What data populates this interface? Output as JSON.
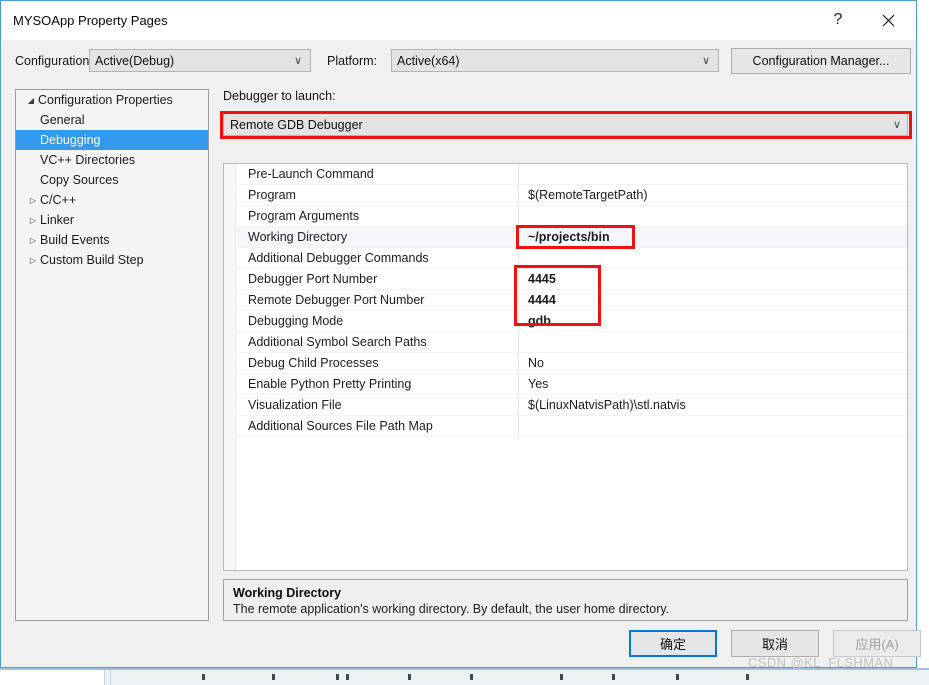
{
  "window": {
    "title": "MYSOApp Property Pages",
    "help_icon": "question-mark-icon",
    "close_icon": "close-x-icon"
  },
  "config_bar": {
    "configuration_label": "Configuration:",
    "configuration_value": "Active(Debug)",
    "platform_label": "Platform:",
    "platform_value": "Active(x64)",
    "configuration_manager_label": "Configuration Manager...",
    "dropdown_arrow": "∨"
  },
  "tree": {
    "items": [
      {
        "label": "Configuration Properties",
        "depth": 0,
        "twisty": "◢",
        "selected": false
      },
      {
        "label": "General",
        "depth": 1,
        "twisty": "",
        "selected": false
      },
      {
        "label": "Debugging",
        "depth": 1,
        "twisty": "",
        "selected": true
      },
      {
        "label": "VC++ Directories",
        "depth": 1,
        "twisty": "",
        "selected": false
      },
      {
        "label": "Copy Sources",
        "depth": 1,
        "twisty": "",
        "selected": false
      },
      {
        "label": "C/C++",
        "depth": 1,
        "twisty": "▷",
        "selected": false
      },
      {
        "label": "Linker",
        "depth": 1,
        "twisty": "▷",
        "selected": false
      },
      {
        "label": "Build Events",
        "depth": 1,
        "twisty": "▷",
        "selected": false
      },
      {
        "label": "Custom Build Step",
        "depth": 1,
        "twisty": "▷",
        "selected": false
      }
    ]
  },
  "main": {
    "debugger_launch_label": "Debugger to launch:",
    "debugger_launch_value": "Remote GDB Debugger",
    "dropdown_arrow": "∨",
    "properties": [
      {
        "name": "Pre-Launch Command",
        "value": "",
        "bold": false,
        "highlight": false
      },
      {
        "name": "Program",
        "value": "$(RemoteTargetPath)",
        "bold": false,
        "highlight": false
      },
      {
        "name": "Program Arguments",
        "value": "",
        "bold": false,
        "highlight": false
      },
      {
        "name": "Working Directory",
        "value": "~/projects/bin",
        "bold": true,
        "highlight": true
      },
      {
        "name": "Additional Debugger Commands",
        "value": "",
        "bold": false,
        "highlight": false
      },
      {
        "name": "Debugger Port Number",
        "value": "4445",
        "bold": true,
        "highlight": false
      },
      {
        "name": "Remote Debugger Port Number",
        "value": "4444",
        "bold": true,
        "highlight": false
      },
      {
        "name": "Debugging Mode",
        "value": "gdb",
        "bold": true,
        "highlight": false
      },
      {
        "name": "Additional Symbol Search Paths",
        "value": "",
        "bold": false,
        "highlight": false
      },
      {
        "name": "Debug Child Processes",
        "value": "No",
        "bold": false,
        "highlight": false
      },
      {
        "name": "Enable Python Pretty Printing",
        "value": "Yes",
        "bold": false,
        "highlight": false
      },
      {
        "name": "Visualization File",
        "value": "$(LinuxNatvisPath)\\stl.natvis",
        "bold": false,
        "highlight": false
      },
      {
        "name": "Additional Sources File Path Map",
        "value": "",
        "bold": false,
        "highlight": false
      }
    ]
  },
  "description": {
    "title": "Working Directory",
    "body": "The remote application's working directory. By default, the user home directory."
  },
  "footer": {
    "ok_label": "确定",
    "cancel_label": "取消",
    "apply_label": "应用(A)"
  },
  "watermark": {
    "text": "CSDN @KL_FLSHMAN"
  },
  "colors": {
    "accent_blue": "#0078d7",
    "selection_blue": "#3399ee",
    "annotation_red": "#ee1111",
    "dialog_face": "#f0f0f0"
  }
}
